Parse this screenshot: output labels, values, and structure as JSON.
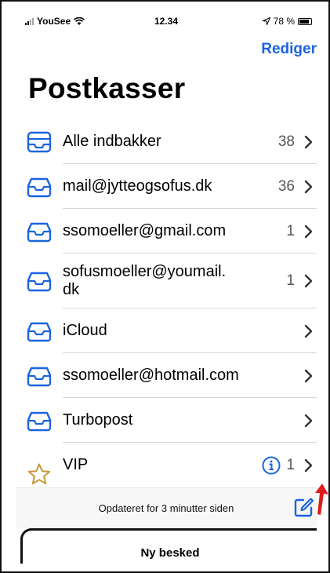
{
  "statusbar": {
    "carrier": "YouSee",
    "time": "12.34",
    "battery": "78 %"
  },
  "header": {
    "edit_label": "Rediger",
    "title": "Postkasser"
  },
  "mailboxes": [
    {
      "label": "Alle indbakker",
      "count": "38",
      "icon": "all-inboxes-icon"
    },
    {
      "label": "mail@jytteogsofus.dk",
      "count": "36",
      "icon": "inbox-icon"
    },
    {
      "label": "ssomoeller@gmail.com",
      "count": "1",
      "icon": "inbox-icon"
    },
    {
      "label": "sofusmoeller@youmail.\ndk",
      "count": "1",
      "icon": "inbox-icon"
    },
    {
      "label": "iCloud",
      "count": "",
      "icon": "inbox-icon"
    },
    {
      "label": "ssomoeller@hotmail.com",
      "count": "",
      "icon": "inbox-icon"
    },
    {
      "label": "Turbopost",
      "count": "",
      "icon": "inbox-icon"
    },
    {
      "label": "VIP",
      "count": "1",
      "icon": "star-icon"
    }
  ],
  "toolbar": {
    "status": "Opdateret for 3 minutter siden"
  },
  "sheet": {
    "label": "Ny besked"
  },
  "colors": {
    "accent": "#1a64e0",
    "star": "#c79a3b",
    "annotation": "#e01b1b"
  }
}
